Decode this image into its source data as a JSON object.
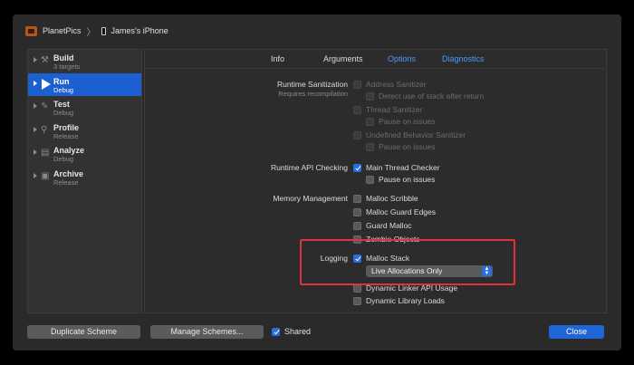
{
  "titlebar": {
    "project": "PlanetPics",
    "separator": "〉",
    "device": "James's iPhone"
  },
  "sidebar": {
    "items": [
      {
        "name": "Build",
        "sub": "3 targets",
        "selected": false
      },
      {
        "name": "Run",
        "sub": "Debug",
        "selected": true
      },
      {
        "name": "Test",
        "sub": "Debug",
        "selected": false
      },
      {
        "name": "Profile",
        "sub": "Release",
        "selected": false
      },
      {
        "name": "Analyze",
        "sub": "Debug",
        "selected": false
      },
      {
        "name": "Archive",
        "sub": "Release",
        "selected": false
      }
    ]
  },
  "tabs": {
    "info": "Info",
    "arguments": "Arguments",
    "options": "Options",
    "diagnostics": "Diagnostics"
  },
  "diagnostics": {
    "runtime_sanitization": {
      "label": "Runtime Sanitization",
      "sublabel": "Requires recompilation",
      "address_sanitizer": "Address Sanitizer",
      "detect_stack_after_return": "Detect use of stack after return",
      "thread_sanitizer": "Thread Sanitizer",
      "thread_pause": "Pause on issues",
      "ub_sanitizer": "Undefined Behavior Sanitizer",
      "ub_pause": "Pause on issues"
    },
    "runtime_api": {
      "label": "Runtime API Checking",
      "main_thread_checker": "Main Thread Checker",
      "pause": "Pause on issues"
    },
    "memory": {
      "label": "Memory Management",
      "malloc_scribble": "Malloc Scribble",
      "malloc_guard_edges": "Malloc Guard Edges",
      "guard_malloc": "Guard Malloc",
      "zombie_objects": "Zombie Objects"
    },
    "logging": {
      "label": "Logging",
      "malloc_stack": "Malloc Stack",
      "malloc_stack_mode": "Live Allocations Only",
      "dynamic_linker_api": "Dynamic Linker API Usage",
      "dynamic_library_loads": "Dynamic Library Loads"
    }
  },
  "footer": {
    "duplicate": "Duplicate Scheme",
    "manage": "Manage Schemes...",
    "shared": "Shared",
    "close": "Close"
  },
  "colors": {
    "accent": "#2066d8",
    "selection": "#1b5fd1",
    "tab_active": "#4c9bff",
    "highlight": "#e0313c"
  }
}
